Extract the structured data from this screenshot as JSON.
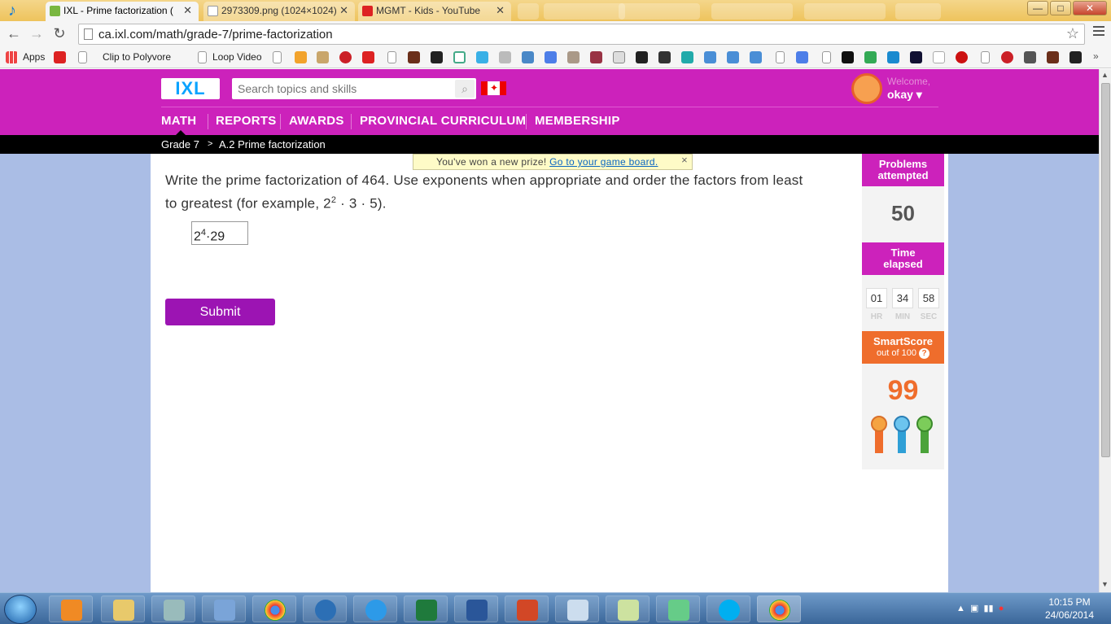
{
  "browser": {
    "tabs": [
      {
        "title": "IXL - Prime factorization (",
        "active": true
      },
      {
        "title": "2973309.png (1024×1024)",
        "active": false
      },
      {
        "title": "MGMT - Kids - YouTube",
        "active": false
      }
    ],
    "url": "ca.ixl.com/math/grade-7/prime-factorization",
    "window_controls": {
      "minimize": "—",
      "maximize": "□",
      "close": "✕"
    }
  },
  "bookmarks": {
    "apps": "Apps",
    "clip_to_polyvore": "Clip to Polyvore",
    "loop_video": "Loop Video"
  },
  "ixl": {
    "logo": "IXL",
    "search_placeholder": "Search topics and skills",
    "welcome": "Welcome,",
    "username": "okay ▾",
    "nav": [
      "MATH",
      "REPORTS",
      "AWARDS",
      "PROVINCIAL CURRICULUM",
      "MEMBERSHIP"
    ],
    "breadcrumb": {
      "grade": "Grade 7",
      "sep": ">",
      "skill": "A.2 Prime factorization"
    },
    "prize": {
      "text": "You've won a new prize!",
      "link": "Go to your game board.",
      "close": "×"
    }
  },
  "question": {
    "text_before": "Write the prime factorization of 464. Use exponents when appropriate and order the factors from least to greatest (for example, 2",
    "example_exp": "2",
    "text_after": " · 3 · 5).",
    "answer_base": "2",
    "answer_exp": "4",
    "answer_rest": "·29",
    "submit": "Submit"
  },
  "sidebar": {
    "problems_label": "Problems attempted",
    "problems_value": "50",
    "time_label": "Time elapsed",
    "time": {
      "hr": "01",
      "min": "34",
      "sec": "58"
    },
    "time_units": {
      "hr": "HR",
      "min": "MIN",
      "sec": "SEC"
    },
    "smartscore_label": "SmartScore",
    "smartscore_sub": "out of 100",
    "smartscore_value": "99",
    "colors": {
      "pink": "#cc22bb",
      "orange": "#ef6d2c"
    }
  },
  "taskbar": {
    "time": "10:15 PM",
    "date": "24/06/2014"
  }
}
